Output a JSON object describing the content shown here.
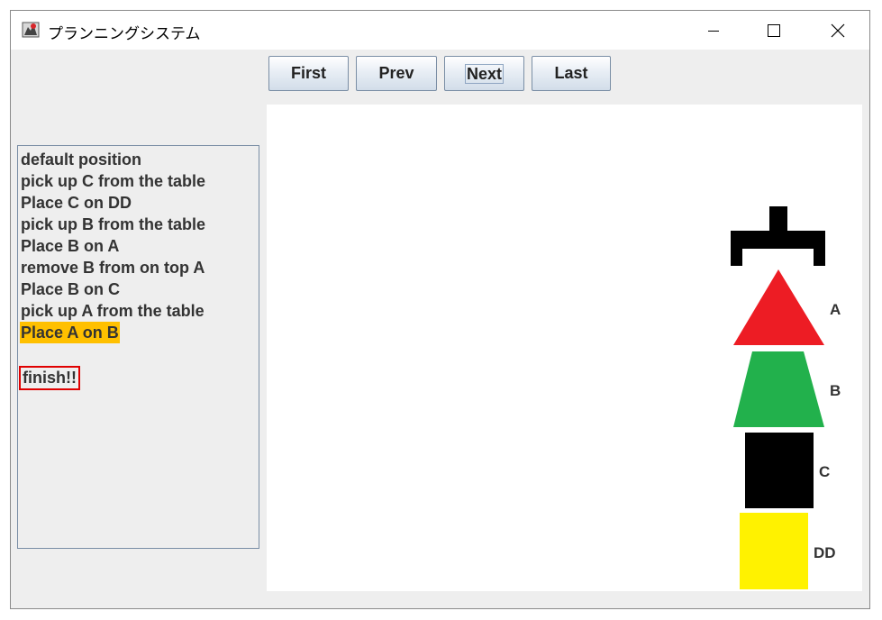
{
  "window": {
    "title": "プランニングシステム"
  },
  "nav": {
    "first": "First",
    "prev": "Prev",
    "next": "Next",
    "last": "Last"
  },
  "steps": [
    "default position",
    "pick up C from the table",
    "Place C on DD",
    "pick up B from the table",
    "Place B on A",
    "remove B from on top A",
    "Place B on C",
    "pick up A from the table",
    "Place A on B"
  ],
  "current_step_index": 8,
  "finish_text": "finish!!",
  "blocks": [
    {
      "label": "A",
      "shape": "triangle",
      "color": "#ed1c24"
    },
    {
      "label": "B",
      "shape": "trapezoid",
      "color": "#22b14c"
    },
    {
      "label": "C",
      "shape": "square",
      "color": "#000000"
    },
    {
      "label": "DD",
      "shape": "square",
      "color": "#fff200"
    }
  ],
  "colors": {
    "highlight": "#ffc000",
    "finish_border": "#e00000",
    "gripper": "#000000"
  },
  "icons": {
    "app": "java-app-icon",
    "minimize": "minimize-icon",
    "maximize": "maximize-icon",
    "close": "close-icon"
  }
}
